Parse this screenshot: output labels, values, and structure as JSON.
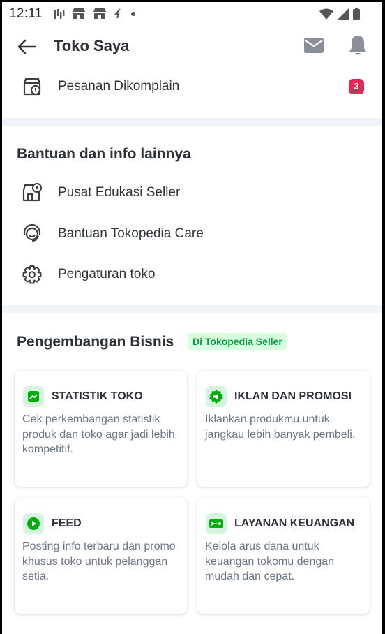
{
  "status_bar": {
    "time": "12:11"
  },
  "app_bar": {
    "title": "Toko Saya"
  },
  "complaint": {
    "label": "Pesanan Dikomplain",
    "badge": "3"
  },
  "help": {
    "title": "Bantuan dan info lainnya",
    "items": [
      {
        "label": "Pusat Edukasi Seller",
        "icon": "store-info-icon"
      },
      {
        "label": "Bantuan Tokopedia Care",
        "icon": "headset-icon"
      },
      {
        "label": "Pengaturan toko",
        "icon": "gear-icon"
      }
    ]
  },
  "business": {
    "title": "Pengembangan Bisnis",
    "pill": "Di Tokopedia Seller",
    "cards": [
      {
        "title": "STATISTIK TOKO",
        "description": "Cek perkembangan statistik produk dan toko agar jadi lebih kompetitif.",
        "icon": "chart-icon"
      },
      {
        "title": "IKLAN DAN PROMOSI",
        "description": "Iklankan produkmu untuk jangkau lebih banyak pembeli.",
        "icon": "megaphone-icon"
      },
      {
        "title": "FEED",
        "description": "Posting info terbaru dan promo khusus toko untuk pelanggan setia.",
        "icon": "play-icon"
      },
      {
        "title": "LAYANAN KEUANGAN",
        "description": "Kelola arus dana untuk keuangan tokomu dengan mudah dan cepat.",
        "icon": "money-icon"
      }
    ]
  },
  "colors": {
    "accent": "#03ac0e",
    "badge": "#e02954",
    "pill_bg": "#d6ffde",
    "text": "#2e3137",
    "muted": "#6d7588"
  }
}
